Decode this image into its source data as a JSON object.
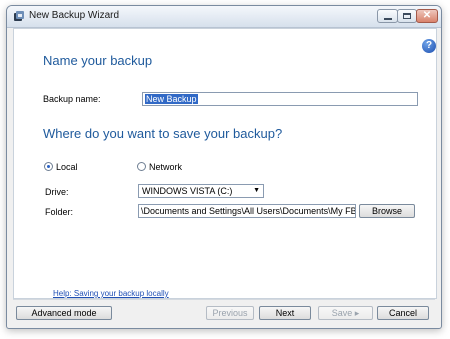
{
  "window": {
    "title": "New Backup Wizard"
  },
  "title_buttons": {
    "close_glyph": "✕"
  },
  "help_icon": {
    "glyph": "?"
  },
  "section_name": {
    "heading": "Name your backup",
    "field_label": "Backup name:",
    "field_value": "New Backup"
  },
  "section_location": {
    "heading": "Where do you want to save your backup?",
    "radio_local_label": "Local",
    "radio_network_label": "Network",
    "selected": "Local",
    "drive_label": "Drive:",
    "drive_value": "WINDOWS VISTA (C:)",
    "drive_caret": "▼",
    "folder_label": "Folder:",
    "folder_value": "\\Documents and Settings\\All Users\\Documents\\My FBackup",
    "browse_label": "Browse"
  },
  "help_link": "Help: Saving your backup locally",
  "footer": {
    "advanced_label": "Advanced mode",
    "previous_label": "Previous",
    "next_label": "Next",
    "save_label": "Save ▸",
    "cancel_label": "Cancel"
  },
  "colors": {
    "heading": "#1f5a9c",
    "link": "#1f4fb5",
    "selection": "#3169c6"
  },
  "icons": [
    "app-icon",
    "minimize-icon",
    "maximize-icon",
    "close-icon",
    "help-icon",
    "chevron-down-icon"
  ]
}
